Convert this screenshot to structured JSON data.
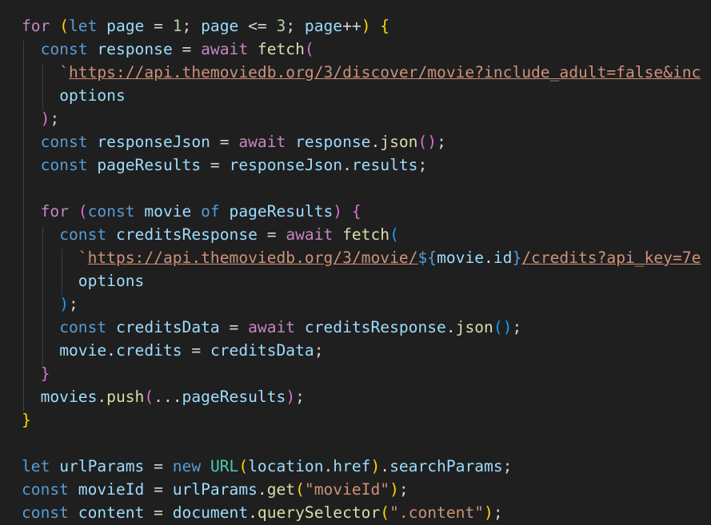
{
  "lines": [
    "for (let page = 1; page <= 3; page++) {",
    "  const response = await fetch(",
    "    `https://api.themoviedb.org/3/discover/movie?include_adult=false&inc",
    "    options",
    "  );",
    "  const responseJson = await response.json();",
    "  const pageResults = responseJson.results;",
    "",
    "  for (const movie of pageResults) {",
    "    const creditsResponse = await fetch(",
    "      `https://api.themoviedb.org/3/movie/${movie.id}/credits?api_key=7e",
    "      options",
    "    );",
    "    const creditsData = await creditsResponse.json();",
    "    movie.credits = creditsData;",
    "  }",
    "  movies.push(...pageResults);",
    "}",
    "",
    "let urlParams = new URL(location.href).searchParams;",
    "const movieId = urlParams.get(\"movieId\");",
    "const content = document.querySelector(\".content\");"
  ],
  "tokens": {
    "url_discover": "https://api.themoviedb.org/3/discover/movie?include_adult=false&inc",
    "url_movie_prefix": "https://api.themoviedb.org/3/movie/",
    "url_movie_suffix": "/credits?api_key=7e",
    "movieId_string": "\"movieId\"",
    "content_string": "\".content\""
  }
}
